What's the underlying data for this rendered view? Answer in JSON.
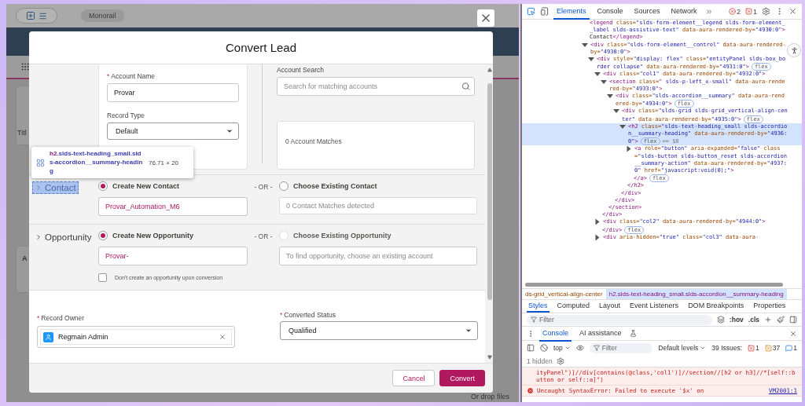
{
  "background_app": {
    "org_pill": "Monorail",
    "title_label": "Titl",
    "tab_label": "A",
    "drop_label": "Or drop files"
  },
  "dialog": {
    "title": "Convert Lead",
    "account": {
      "required_mark": "*",
      "name_label": "Account Name",
      "name_value": "Provar",
      "record_type_label": "Record Type",
      "record_type_value": "Default",
      "search_label": "Account Search",
      "search_placeholder": "Search for matching accounts",
      "matches": "0 Account Matches"
    },
    "sections": [
      {
        "title": "Contact",
        "expanded": false,
        "inspected": true,
        "create_label": "Create New Contact",
        "create_selected": true,
        "create_value": "Provar_Automation_M6",
        "or_label": "- OR -",
        "existing_label": "Choose Existing Contact",
        "existing_selected": false,
        "existing_disabled": false,
        "existing_field": {
          "kind": "status",
          "text": "0 Contact Matches detected"
        }
      },
      {
        "title": "Opportunity",
        "expanded": false,
        "inspected": false,
        "create_label": "Create New Opportunity",
        "create_selected": true,
        "create_value": "Provar-",
        "or_label": "- OR -",
        "existing_label": "Choose Existing Opportunity",
        "existing_selected": false,
        "existing_disabled": true,
        "existing_field": {
          "kind": "input",
          "placeholder": "To find opportunity, choose an existing account"
        },
        "skip_option": {
          "label": "Don't create an opportunity upon conversion",
          "checked": false
        }
      }
    ],
    "record_owner": {
      "required_mark": "*",
      "label": "Record Owner",
      "value": "Regmain Admin"
    },
    "converted_status": {
      "required_mark": "*",
      "label": "Converted Status",
      "value": "Qualified"
    },
    "buttons": [
      {
        "label": "Cancel",
        "kind": "neutral"
      },
      {
        "label": "Convert",
        "kind": "brand"
      }
    ]
  },
  "inspect_tooltip": {
    "tag": "h2",
    "selector": ".slds-text-heading_small.slds-accordion__summary-heading",
    "size": "76.71 × 20"
  },
  "devtools": {
    "tabs": [
      {
        "label": "Elements",
        "selected": true
      },
      {
        "label": "Console",
        "selected": false
      },
      {
        "label": "Sources",
        "selected": false
      },
      {
        "label": "Network",
        "selected": false
      }
    ],
    "error_count": "2",
    "warning_count": "1",
    "dom_tree": [
      {
        "open": "<legend class=\"slds-form-element__legend slds-form-element__label slds-assistive-text\" data-aura-rendered-by=\"4930:0\">Contact</legend>",
        "selected": false
      },
      {
        "open": "<div class=\"slds-form-element__control\" data-aura-rendered-by=\"4930:0\">",
        "selected": false,
        "expanded": true,
        "children": [
          {
            "open": "<div style=\"display: flex\" class=\"entityPanel slds-box_border collapse\" data-aura-rendered-by=\"4931:0\">",
            "badges": [
              "flex"
            ],
            "selected": false,
            "expanded": true,
            "children": [
              {
                "open": "<div class=\"col1\" data-aura-rendered-by=\"4932:0\">",
                "selected": false,
                "expanded": true,
                "children": [
                  {
                    "open": "<section class=\" slds-p-left_x-small\" data-aura-rendered-by=\"4933:0\">",
                    "selected": false,
                    "expanded": true,
                    "children": [
                      {
                        "open": "<div class=\"slds-accordion__summary\" data-aura-rendered-by=\"4934:0\">",
                        "badges": [
                          "flex"
                        ],
                        "selected": false,
                        "expanded": true,
                        "children": [
                          {
                            "open": "<div class=\"slds-grid slds-grid_vertical-align-center\" data-aura-rendered-by=\"4935:0\">",
                            "badges": [
                              "flex"
                            ],
                            "selected": false,
                            "expanded": true,
                            "children": [
                              {
                                "open": "<h2 class=\"slds-text-heading_small slds-accordion__summary-heading\" data-aura-rendered-by=\"4936:0\">",
                                "badges": [
                                  "flex"
                                ],
                                "hint": "== $0",
                                "selected": true,
                                "expanded": true,
                                "children": [
                                  {
                                    "open": "<a role=\"button\" aria-expanded=\"false\" class=\"slds-button slds-button_reset slds-accordion__summary-action\" data-aura-rendered-by=\"4937:0\" href=\"javascript:void(0);\">",
                                    "selected": false,
                                    "expanded": false,
                                    "close": "</a>",
                                    "close_badges": [
                                      "flex"
                                    ]
                                  }
                                ],
                                "close": "</h2>"
                              }
                            ],
                            "close": "</div>"
                          }
                        ],
                        "close": "</div>"
                      }
                    ],
                    "close": "</section>"
                  }
                ],
                "close": "</div>"
              },
              {
                "open": "<div class=\"col2\" data-aura-rendered-by=\"4944:0\">",
                "selected": false,
                "expanded": false,
                "close": "</div>",
                "close_badges": [
                  "flex"
                ]
              },
              {
                "open": "<div aria-hidden=\"true\" class=\"col3\" data-aura-",
                "selected": false,
                "expanded": false
              }
            ]
          }
        ]
      }
    ],
    "breadcrumbs": [
      {
        "label": "ds-grid_vertical-align-center",
        "selected": false
      },
      {
        "label": "h2.slds-text-heading_small.slds-accordion__summary-heading",
        "selected": true
      }
    ],
    "style_tabs": [
      {
        "label": "Styles",
        "selected": true
      },
      {
        "label": "Computed",
        "selected": false
      },
      {
        "label": "Layout",
        "selected": false
      },
      {
        "label": "Event Listeners",
        "selected": false
      },
      {
        "label": "DOM Breakpoints",
        "selected": false
      },
      {
        "label": "Properties",
        "selected": false
      }
    ],
    "styles_filter_placeholder": "Filter",
    "styles_tools": [
      ":hov",
      ".cls"
    ],
    "drawer_tabs": [
      {
        "label": "Console",
        "selected": true
      },
      {
        "label": "AI assistance",
        "selected": false
      }
    ],
    "console_context": "top",
    "console_filter_placeholder": "Filter",
    "levels": "Default levels",
    "issues_label": "39 Issues:",
    "issue_counts": [
      {
        "kind": "error",
        "count": "1"
      },
      {
        "kind": "warning",
        "count": "37"
      },
      {
        "kind": "info",
        "count": "1"
      }
    ],
    "hidden_label": "1 hidden",
    "messages": [
      {
        "kind": "continuation",
        "text": "ityPanel\")]//div[contains(@class,'col1')]//section//[h2 or h3]//*[self::button or self::a]\")"
      },
      {
        "kind": "error",
        "text": "Uncaught SyntaxError: Failed to execute '$x' on",
        "source": "VM2001:1"
      }
    ]
  }
}
